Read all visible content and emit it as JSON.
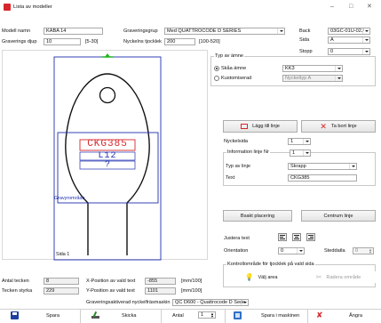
{
  "window": {
    "title": "Lista av modeller",
    "minimize": "–",
    "maximize": "□",
    "close": "✕"
  },
  "form": {
    "model_name_label": "Modell namn",
    "model_name_value": "KABA 14",
    "engraving_group_label": "Graveringsgrup",
    "engraving_group_value": "Med QUATTROCODE D SERIES",
    "depth_label": "Graverings djup",
    "depth_value": "10",
    "depth_range": "[5-30]",
    "thickness_label": "Nyckelns tjocklek",
    "thickness_value": "200",
    "thickness_range": "[100-520]",
    "back_label": "Back",
    "back_value": "03GC-01U-02J",
    "side_label": "Sida",
    "side_value": "A",
    "stop_label": "Stopp",
    "stop_value": "0"
  },
  "preview": {
    "line1": "CKG385",
    "line2": "L12",
    "line3": "?",
    "engraving_area_label": "Gravyrområde",
    "page_label": "Sida 1"
  },
  "type_group": {
    "title": "Typ av ämne",
    "option_blank": "Skåa ämne",
    "option_custom": "Kustomiserad",
    "blank_select": "KK3",
    "custom_select": "Nyckeltyp A"
  },
  "lines": {
    "add_line": "Lägg till linje",
    "remove_line": "Ta bort linje",
    "key_side_label": "Nyckelsida",
    "key_side_value": "1",
    "info_group_title": "Information linje Nr",
    "info_line_value": "1",
    "line_type_label": "Typ av linje",
    "line_type_value": "Skrapp",
    "text_label": "Text",
    "text_value": "CKG385"
  },
  "layout": {
    "build_placement": "Bsakt placering",
    "center_lines": "Centrum linje",
    "adjust_text_label": "Justera text",
    "orientation_label": "Orientation",
    "orientation_value": "0",
    "step_label": "Steddatla",
    "step_value": "0"
  },
  "control_group": {
    "title": "Kontrollområde för tjocklek på vald sida",
    "choose_area": "Välj area",
    "remove_area": "Radera område"
  },
  "status": {
    "char_count_label": "Antal tecken",
    "char_count_value": "8",
    "char_strength_label": "Tecken styrka",
    "char_strength_value": "229",
    "x_pos_label": "X-Position av vald text",
    "x_pos_value": "-855",
    "x_unit": "[mm/100]",
    "y_pos_label": "Y-Position av vald text",
    "y_pos_value": "1101",
    "y_unit": "[mm/100]",
    "machine_label": "Graveringsaktiverad nyckelfräsmaskin",
    "machine_value": "QC D600 - Quattrocode D Serie"
  },
  "toolbar": {
    "save": "Spara",
    "sketch": "Skicka",
    "count_label": "Antal",
    "count_value": "1",
    "save_machine": "Spara i maskinen",
    "cancel": "Ångra"
  },
  "colors": {
    "accent_red": "#d7262b",
    "engraving_blue": "#1e2fb0",
    "key_green": "#21b521"
  }
}
